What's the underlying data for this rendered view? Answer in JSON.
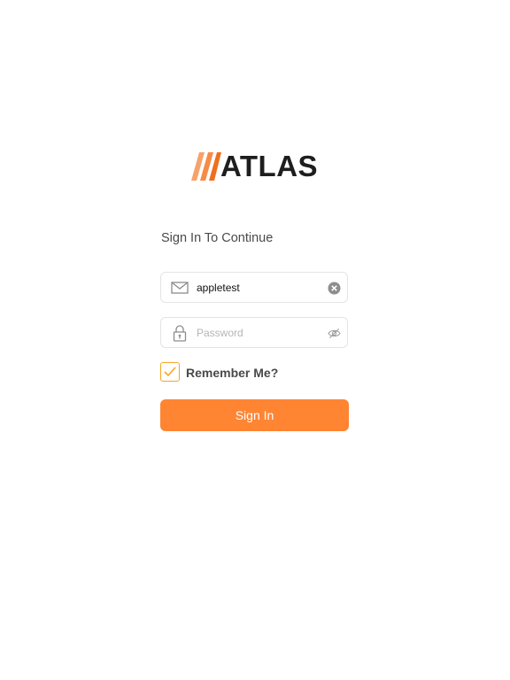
{
  "logo": {
    "text": "ATLAS",
    "accent_color": "#F58232",
    "text_color": "#1E1E1E"
  },
  "login": {
    "heading": "Sign In To Continue",
    "email": {
      "value": "appletest",
      "placeholder": "",
      "icon": "mail-icon",
      "action_icon": "clear-icon"
    },
    "password": {
      "value": "",
      "placeholder": "Password",
      "icon": "lock-icon",
      "action_icon": "eye-icon"
    },
    "remember": {
      "label": "Remember Me?",
      "checked": true,
      "border_color": "#F5A623"
    },
    "submit_label": "Sign In",
    "submit_color": "#FF8533"
  }
}
